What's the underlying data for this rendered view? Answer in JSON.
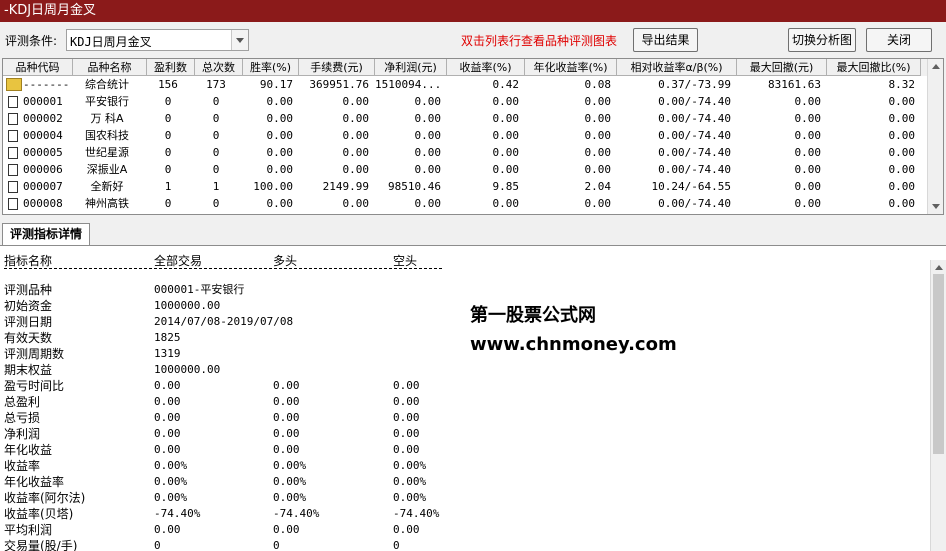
{
  "window": {
    "title": "-KDJ日周月金叉"
  },
  "toolbar": {
    "condition_label": "评测条件:",
    "condition_value": "KDJ日周月金叉",
    "hint": "双击列表行查看品种评测图表",
    "export_label": "导出结果",
    "switch_label": "切换分析图",
    "close_label": "关闭"
  },
  "grid": {
    "columns": [
      "品种代码",
      "品种名称",
      "盈利数",
      "总次数",
      "胜率(%)",
      "手续费(元)",
      "净利润(元)",
      "收益率(%)",
      "年化收益率(%)",
      "相对收益率α/β(%)",
      "最大回撤(元)",
      "最大回撤比(%)"
    ],
    "rows": [
      [
        "-------",
        "综合统计",
        "156",
        "173",
        "90.17",
        "369951.76",
        "1510094...",
        "0.42",
        "0.08",
        "0.37/-73.99",
        "83161.63",
        "8.32"
      ],
      [
        "000001",
        "平安银行",
        "0",
        "0",
        "0.00",
        "0.00",
        "0.00",
        "0.00",
        "0.00",
        "0.00/-74.40",
        "0.00",
        "0.00"
      ],
      [
        "000002",
        "万 科A",
        "0",
        "0",
        "0.00",
        "0.00",
        "0.00",
        "0.00",
        "0.00",
        "0.00/-74.40",
        "0.00",
        "0.00"
      ],
      [
        "000004",
        "国农科技",
        "0",
        "0",
        "0.00",
        "0.00",
        "0.00",
        "0.00",
        "0.00",
        "0.00/-74.40",
        "0.00",
        "0.00"
      ],
      [
        "000005",
        "世纪星源",
        "0",
        "0",
        "0.00",
        "0.00",
        "0.00",
        "0.00",
        "0.00",
        "0.00/-74.40",
        "0.00",
        "0.00"
      ],
      [
        "000006",
        "深振业A",
        "0",
        "0",
        "0.00",
        "0.00",
        "0.00",
        "0.00",
        "0.00",
        "0.00/-74.40",
        "0.00",
        "0.00"
      ],
      [
        "000007",
        "全新好",
        "1",
        "1",
        "100.00",
        "2149.99",
        "98510.46",
        "9.85",
        "2.04",
        "10.24/-64.55",
        "0.00",
        "0.00"
      ],
      [
        "000008",
        "神州高铁",
        "0",
        "0",
        "0.00",
        "0.00",
        "0.00",
        "0.00",
        "0.00",
        "0.00/-74.40",
        "0.00",
        "0.00"
      ]
    ]
  },
  "detail": {
    "tab_label": "评测指标详情",
    "headers": [
      "指标名称",
      "全部交易",
      "多头",
      "空头"
    ],
    "rows": [
      [
        "评测品种",
        "000001-平安银行",
        "",
        ""
      ],
      [
        "初始资金",
        "1000000.00",
        "",
        ""
      ],
      [
        "评测日期",
        "2014/07/08-2019/07/08",
        "",
        ""
      ],
      [
        "有效天数",
        "1825",
        "",
        ""
      ],
      [
        "评测周期数",
        "1319",
        "",
        ""
      ],
      [
        "期末权益",
        "1000000.00",
        "",
        ""
      ],
      [
        "盈亏时间比",
        "0.00",
        "0.00",
        "0.00"
      ],
      [
        "总盈利",
        "0.00",
        "0.00",
        "0.00"
      ],
      [
        "总亏损",
        "0.00",
        "0.00",
        "0.00"
      ],
      [
        "净利润",
        "0.00",
        "0.00",
        "0.00"
      ],
      [
        "年化收益",
        "0.00",
        "0.00",
        "0.00"
      ],
      [
        "收益率",
        "0.00%",
        "0.00%",
        "0.00%"
      ],
      [
        "年化收益率",
        "0.00%",
        "0.00%",
        "0.00%"
      ],
      [
        "收益率(阿尔法)",
        "0.00%",
        "0.00%",
        "0.00%"
      ],
      [
        "收益率(贝塔)",
        "-74.40%",
        "-74.40%",
        "-74.40%"
      ],
      [
        "平均利润",
        "0.00",
        "0.00",
        "0.00"
      ],
      [
        "交易量(股/手)",
        "0",
        "0",
        "0"
      ]
    ],
    "watermark_title": "第一股票公式网",
    "watermark_url": "www.chnmoney.com"
  },
  "colors": {
    "titlebar": "#8b1a1a",
    "hint": "#e00000",
    "summary_icon": "#e8c440"
  }
}
